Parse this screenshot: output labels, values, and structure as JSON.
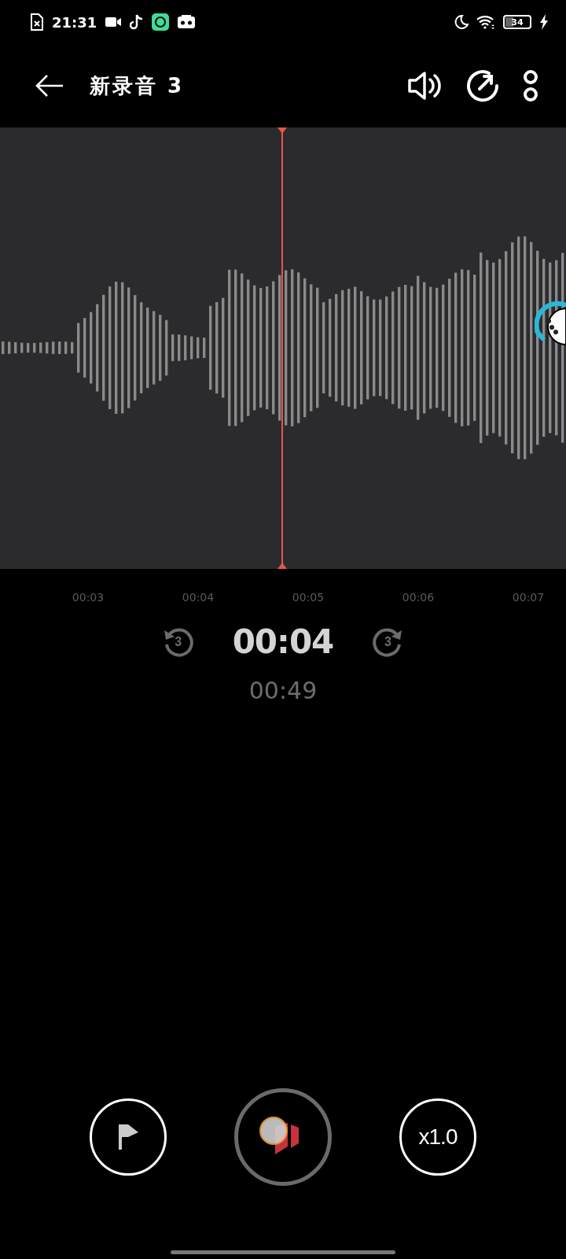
{
  "status_bar": {
    "time": "21:31",
    "battery": "34"
  },
  "title": "新录音 3",
  "timeline": {
    "ticks": [
      "00:03",
      "00:04",
      "00:05",
      "00:06",
      "00:07"
    ]
  },
  "position": "00:04",
  "duration": "00:49",
  "skip_back": "3",
  "skip_forward": "3",
  "speed": "x1.0"
}
